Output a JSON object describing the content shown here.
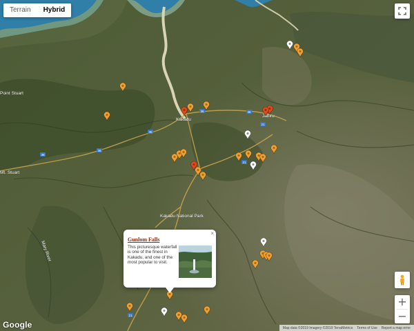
{
  "map_type": {
    "terrain_label": "Terrain",
    "hybrid_label": "Hybrid",
    "selected": "Hybrid"
  },
  "places": [
    {
      "label": "Kakadu"
    },
    {
      "label": "Jabiru"
    },
    {
      "label": "Point Stuart"
    },
    {
      "label": "Kakadu National Park"
    },
    {
      "label": "Mary River"
    },
    {
      "label": "Mt. Stuart"
    }
  ],
  "road_shields": [
    {
      "label": "36"
    },
    {
      "label": "36"
    },
    {
      "label": "36"
    },
    {
      "label": "36"
    },
    {
      "label": "36"
    },
    {
      "label": "21"
    },
    {
      "label": "21"
    },
    {
      "label": "21"
    }
  ],
  "info_window": {
    "title": "Gunlom Falls",
    "description": "This picturesque waterfall is one of the finest in Kakadu, and one of the most popular to visit.",
    "close_symbol": "×"
  },
  "attribution": {
    "map_data": "Map data ©2019 Imagery ©2019 TerraMetrics",
    "terms": "Terms of Use",
    "report": "Report a map error"
  },
  "logo": "Google",
  "zoom": {
    "in": "+",
    "out": "−"
  },
  "colors": {
    "marker_orange": "#f0a030",
    "marker_red": "#e04a1c",
    "marker_white": "#ffffff",
    "title_link": "#8b2c12",
    "water": "#2f7fa8"
  },
  "icons": {
    "fullscreen": "fullscreen-icon",
    "pegman": "pegman-icon",
    "close": "close-icon"
  }
}
